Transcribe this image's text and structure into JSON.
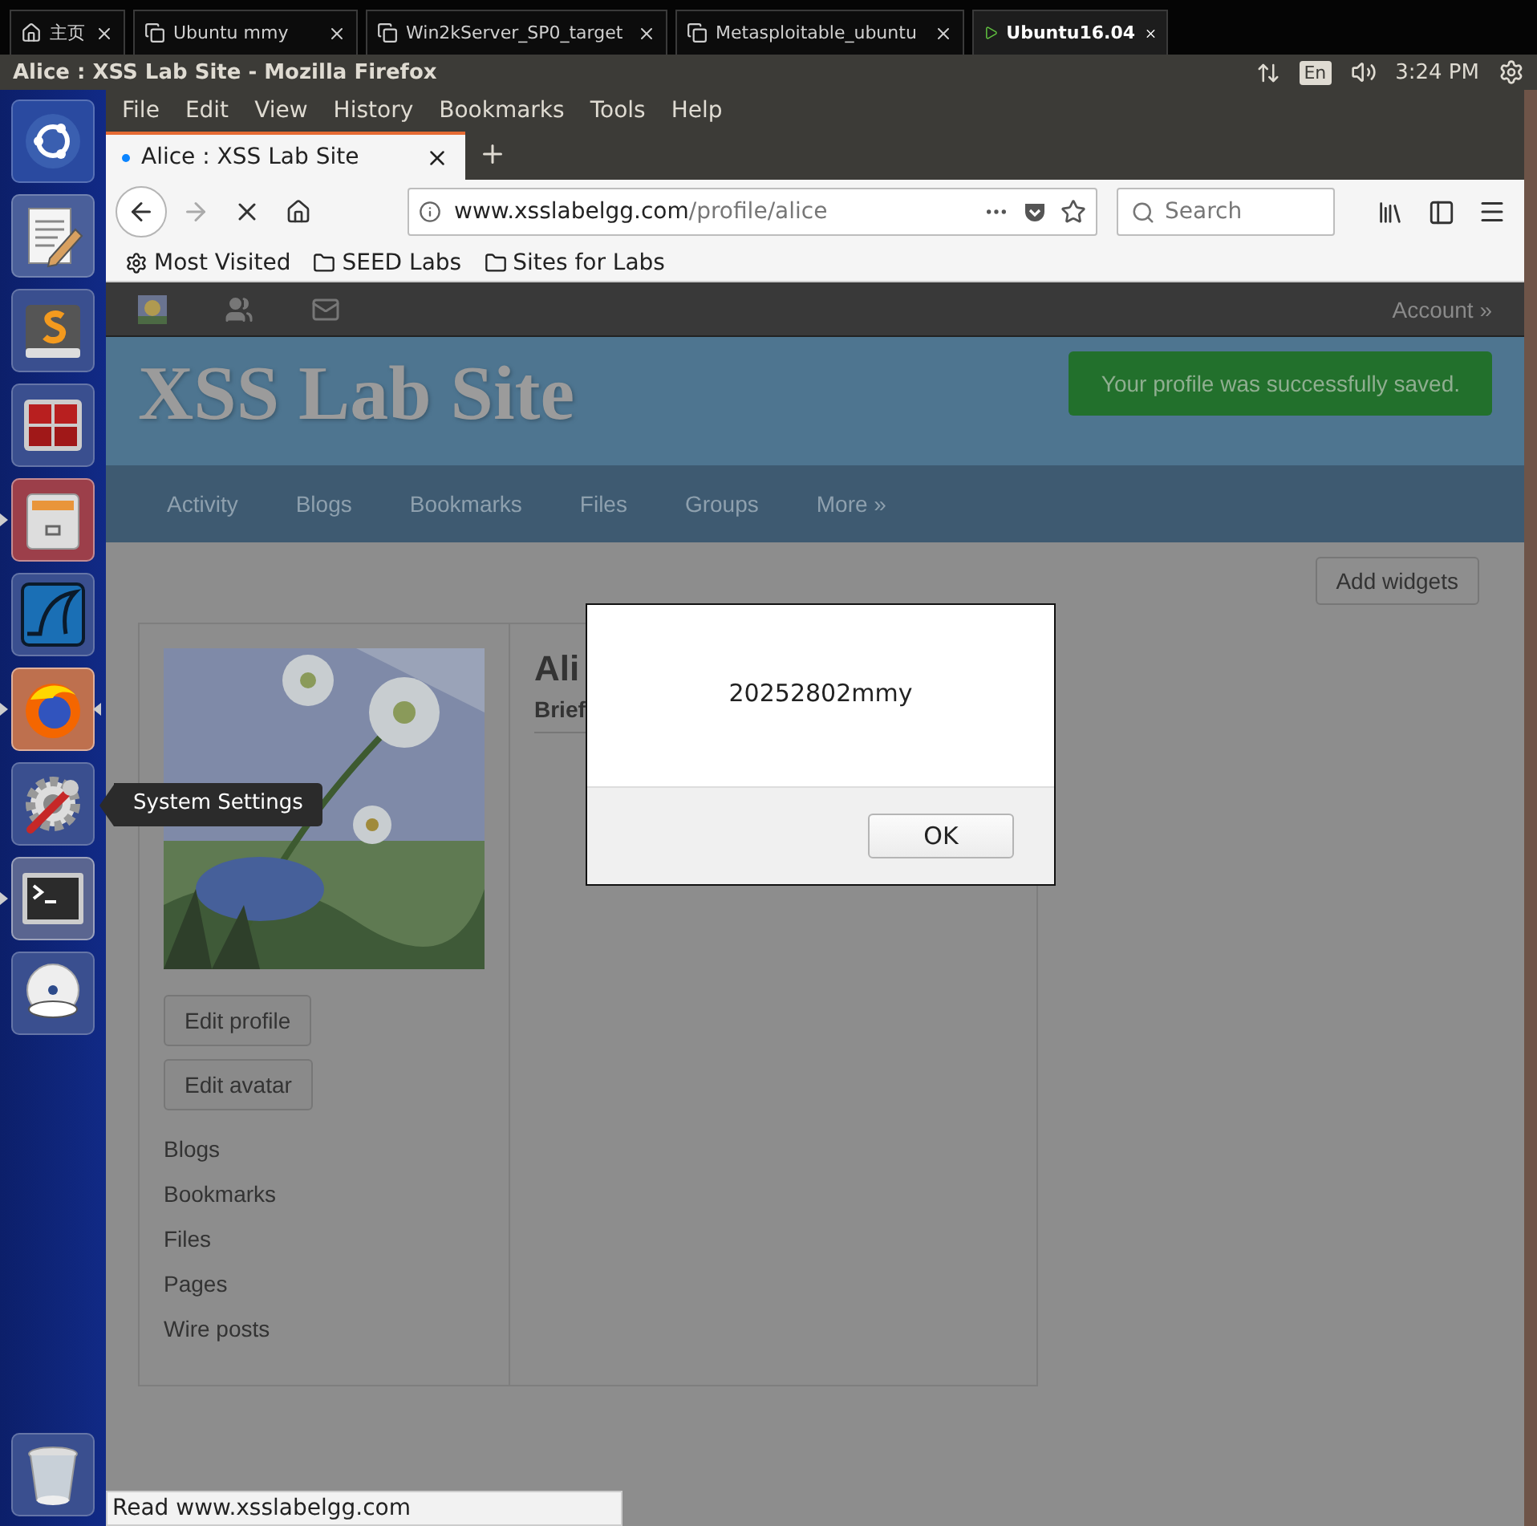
{
  "vm_tabs": [
    {
      "label": "主页",
      "kind": "home",
      "selected": false
    },
    {
      "label": "Ubuntu mmy",
      "kind": "vm",
      "selected": false
    },
    {
      "label": "Win2kServer_SP0_target",
      "kind": "vm",
      "selected": false
    },
    {
      "label": "Metasploitable_ubuntu",
      "kind": "vm",
      "selected": false
    },
    {
      "label": "Ubuntu16.04",
      "kind": "running",
      "selected": true
    }
  ],
  "top_bar": {
    "title": "Alice : XSS Lab Site - Mozilla Firefox",
    "keyboard": "En",
    "clock": "3:24 PM"
  },
  "launcher": {
    "items": [
      {
        "kind": "dash",
        "running": false,
        "focused": false
      },
      {
        "kind": "editor",
        "running": false,
        "focused": false
      },
      {
        "kind": "sublime",
        "running": false,
        "focused": false
      },
      {
        "kind": "terminals",
        "running": false,
        "focused": false
      },
      {
        "kind": "files",
        "running": true,
        "focused": false
      },
      {
        "kind": "shark",
        "running": false,
        "focused": false
      },
      {
        "kind": "firefox",
        "running": true,
        "focused": true
      },
      {
        "kind": "settings",
        "running": false,
        "focused": false
      },
      {
        "kind": "terminal",
        "running": true,
        "focused": false
      },
      {
        "kind": "dvd",
        "running": false,
        "focused": false
      }
    ],
    "trash": {
      "kind": "trash",
      "running": false,
      "focused": false
    },
    "tooltip": "System Settings"
  },
  "menu": [
    "File",
    "Edit",
    "View",
    "History",
    "Bookmarks",
    "Tools",
    "Help"
  ],
  "browser_tab": {
    "title": "Alice : XSS Lab Site",
    "loading": true
  },
  "address": {
    "host": "www.xsslabelgg.com",
    "path": "/profile/alice"
  },
  "search": {
    "placeholder": "Search"
  },
  "bookmarks": [
    {
      "label": "Most Visited",
      "kind": "gear"
    },
    {
      "label": "SEED Labs",
      "kind": "folder"
    },
    {
      "label": "Sites for Labs",
      "kind": "folder"
    }
  ],
  "site": {
    "account": "Account »",
    "title": "XSS Lab Site",
    "message": "Your profile was successfully saved.",
    "nav": [
      "Activity",
      "Blogs",
      "Bookmarks",
      "Files",
      "Groups",
      "More »"
    ],
    "add_widgets": "Add widgets",
    "profile": {
      "name": "Ali",
      "brief": "Brief",
      "buttons": [
        "Edit profile",
        "Edit avatar"
      ],
      "links": [
        "Blogs",
        "Bookmarks",
        "Files",
        "Pages",
        "Wire posts"
      ]
    }
  },
  "dialog": {
    "message": "20252802mmy",
    "button": "OK"
  },
  "status": "Read www.xsslabelgg.com"
}
